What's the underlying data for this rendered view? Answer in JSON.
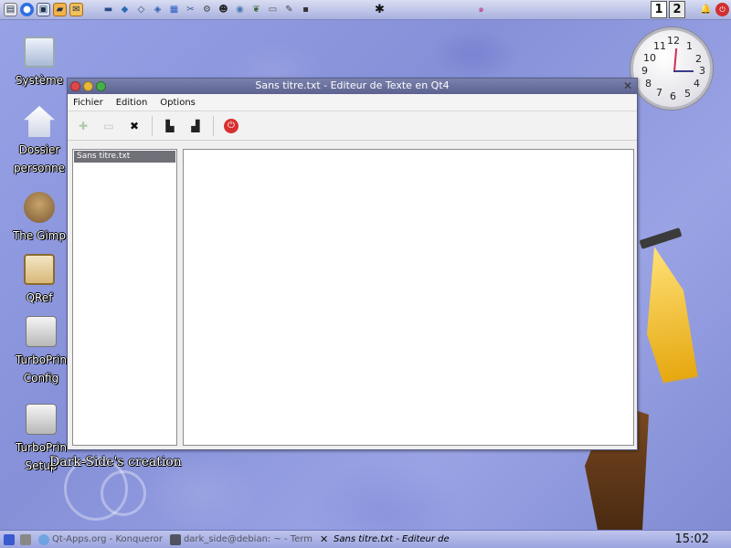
{
  "desktop": {
    "icons": [
      {
        "label": "Système",
        "label2": "",
        "icon": "monitor-icon"
      },
      {
        "label": "Dossier",
        "label2": "personne",
        "icon": "home-folder-icon"
      },
      {
        "label": "The Gimp",
        "label2": "",
        "icon": "gimp-icon"
      },
      {
        "label": "QRef",
        "label2": "",
        "icon": "notebook-icon"
      },
      {
        "label": "TurboPrin",
        "label2": "Config",
        "icon": "printer-icon"
      },
      {
        "label": "TurboPrin",
        "label2": "Setup",
        "icon": "printer-icon"
      }
    ],
    "credit": "Dark-Side's creation"
  },
  "top_panel": {
    "pager": [
      "1",
      "2"
    ]
  },
  "clock": {
    "numbers": [
      "12",
      "1",
      "2",
      "3",
      "4",
      "5",
      "6",
      "7",
      "8",
      "9",
      "10",
      "11"
    ],
    "digital": "15:02"
  },
  "window": {
    "title": "Sans titre.txt  - Editeur de Texte en Qt4",
    "menu": [
      "Fichier",
      "Edition",
      "Options"
    ],
    "toolbar": [
      {
        "name": "new-document-icon",
        "glyph": "✚",
        "enabled": false
      },
      {
        "name": "open-document-icon",
        "glyph": "▭",
        "enabled": false
      },
      {
        "name": "close-document-icon",
        "glyph": "✖",
        "enabled": true
      },
      {
        "name": "save-icon",
        "glyph": "💾",
        "enabled": true
      },
      {
        "name": "save-as-icon",
        "glyph": "💾",
        "enabled": true
      },
      {
        "name": "quit-icon",
        "glyph": "⏻",
        "enabled": true
      }
    ],
    "documents": [
      "Sans titre.txt"
    ]
  },
  "taskbar": {
    "tasks": [
      {
        "label": "Qt-Apps.org - Konqueror",
        "active": false
      },
      {
        "label": "dark_side@debian: ~ - Term",
        "active": false
      },
      {
        "label": "Sans titre.txt  - Editeur de",
        "active": true
      }
    ]
  },
  "colors": {
    "wallpaper": "#8f9bde",
    "titlebar": "#5c628f",
    "selection": "#707078"
  }
}
